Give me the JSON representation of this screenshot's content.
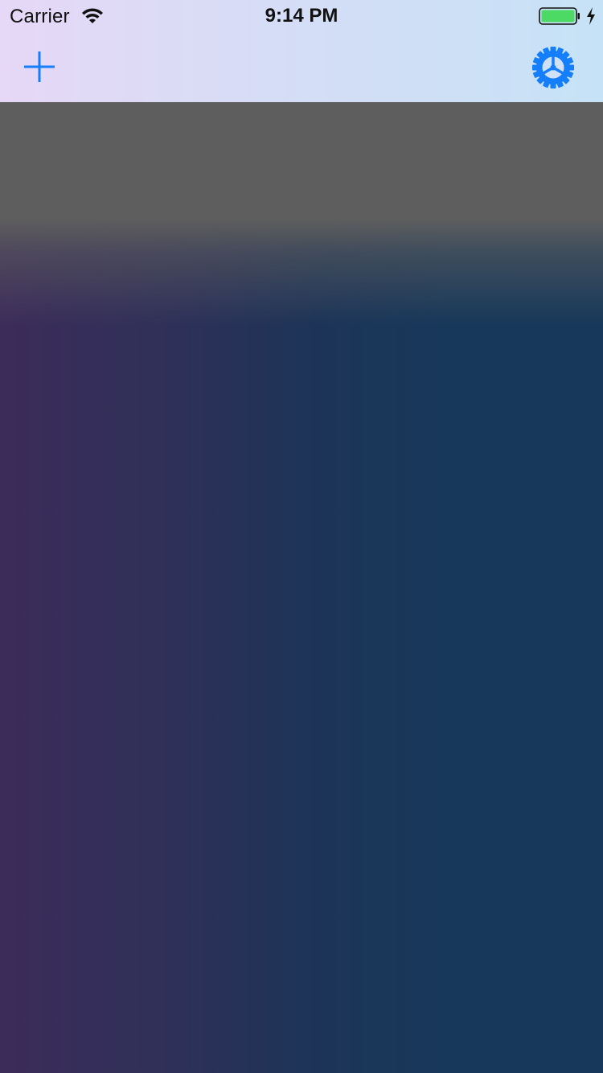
{
  "status_bar": {
    "carrier": "Carrier",
    "time": "9:14 PM",
    "icons": {
      "wifi": "wifi-icon",
      "battery": "battery-icon",
      "charging": "charging-bolt-icon"
    },
    "battery_color": "#4cd964"
  },
  "nav_bar": {
    "left_button_icon": "plus-icon",
    "right_button_icon": "gear-icon",
    "accent_color": "#147efb"
  },
  "colors": {
    "header_gradient": [
      "#e6d8f6",
      "#c6e2f6"
    ],
    "content_top": "#5e5e5e",
    "content_gradient": [
      "#3c2c5a",
      "#17385a"
    ]
  }
}
